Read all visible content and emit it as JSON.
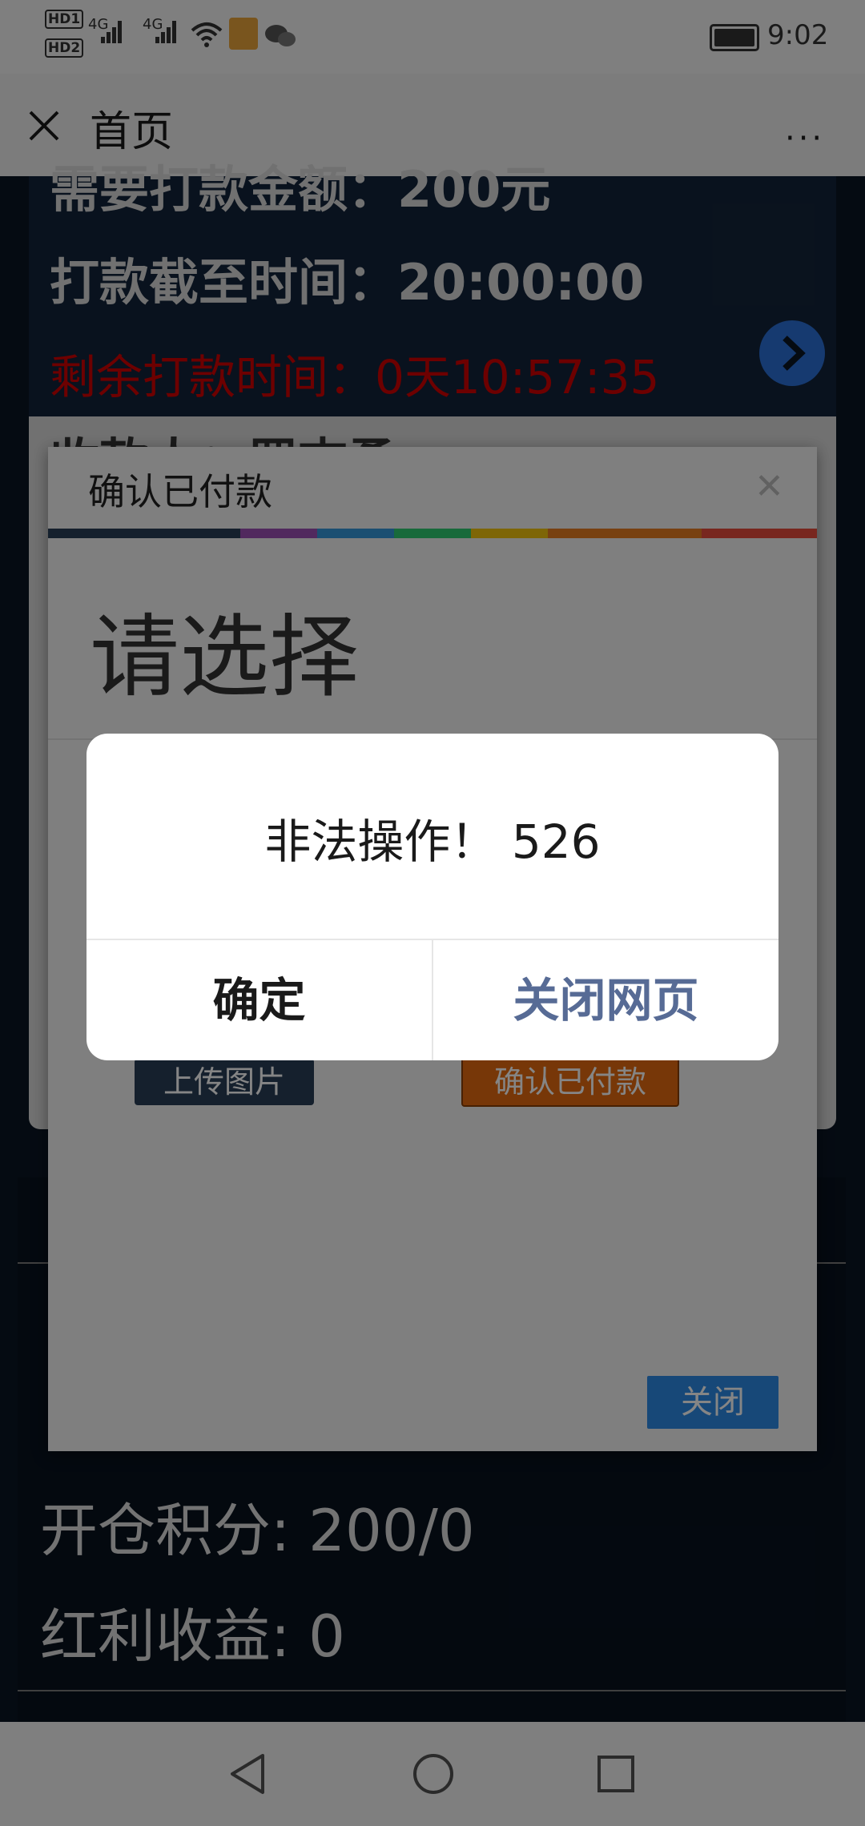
{
  "status_bar": {
    "hd1": "HD1",
    "hd2": "HD2",
    "net1": "4G",
    "net2": "4G",
    "time": "9:02",
    "icons": [
      "signal-icon",
      "wifi-icon",
      "app-notification-icon",
      "wechat-icon",
      "battery-icon"
    ]
  },
  "nav": {
    "title": "首页",
    "more": "···"
  },
  "page": {
    "partial_top_line": "需要打款金额：200元",
    "deadline": "打款截至时间：20:00:00",
    "remaining": "剩余打款时间：0天10:57:35",
    "payee_partial": "收款人：罗志勇",
    "stat_open_points": "开仓积分: 200/0",
    "stat_dividend": "红利收益: 0"
  },
  "modal": {
    "title": "确认已付款",
    "heading": "请选择",
    "upload_label": "上传图片",
    "confirm_paid_label": "确认已付款",
    "close_label": "关闭",
    "stripe_colors": [
      "#2a3f57",
      "#9b4fb4",
      "#3498db",
      "#2ecc71",
      "#f1c40f",
      "#e67e22",
      "#e74c3c"
    ]
  },
  "alert": {
    "message": "非法操作！ 526",
    "ok_label": "确定",
    "close_page_label": "关闭网页",
    "close_page_color": "#576b95"
  },
  "system_nav": {
    "icons": [
      "back-icon",
      "home-icon",
      "recents-icon"
    ]
  }
}
